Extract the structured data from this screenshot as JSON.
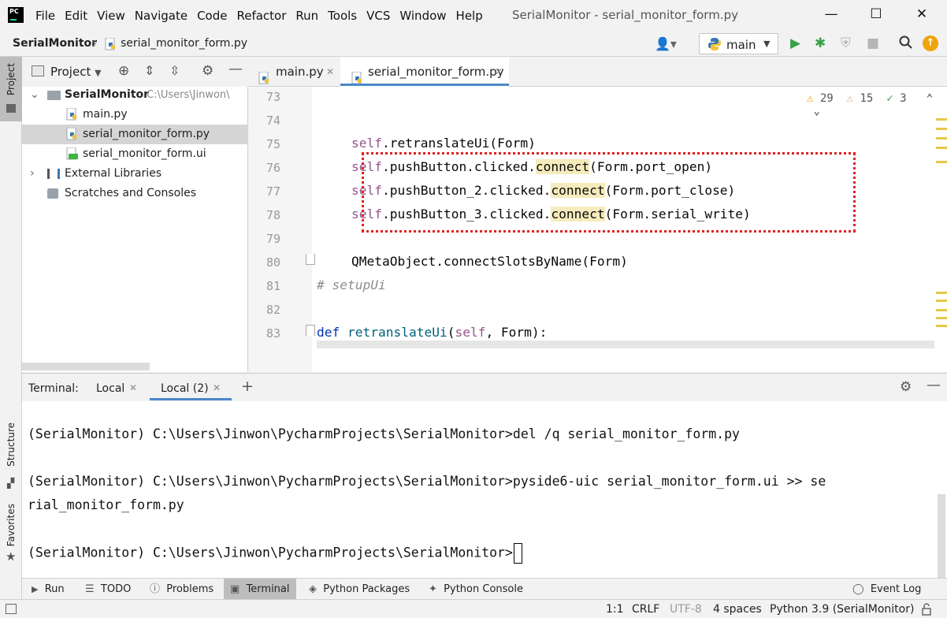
{
  "window": {
    "title": "SerialMonitor - serial_monitor_form.py",
    "logo_text": "PC",
    "menu": [
      "File",
      "Edit",
      "View",
      "Navigate",
      "Code",
      "Refactor",
      "Run",
      "Tools",
      "VCS",
      "Window",
      "Help"
    ],
    "controls": {
      "minimize": "—",
      "maximize": "☐",
      "close": "✕"
    }
  },
  "navbar": {
    "project": "SerialMonitor",
    "separator": "›",
    "file": "serial_monitor_form.py",
    "run_config": "main"
  },
  "left_strip": {
    "project": "Project",
    "structure": "Structure",
    "favorites": "Favorites"
  },
  "project_panel": {
    "title": "Project",
    "tree": [
      {
        "label": "SerialMonitor",
        "path": "C:\\Users\\Jinwon\\",
        "expanded": "⌄"
      },
      {
        "label": "main.py"
      },
      {
        "label": "serial_monitor_form.py"
      },
      {
        "label": "serial_monitor_form.ui"
      },
      {
        "label": "External Libraries",
        "expanded": "›"
      },
      {
        "label": "Scratches and Consoles"
      }
    ]
  },
  "editor_tabs": [
    {
      "label": "main.py",
      "close": "✕"
    },
    {
      "label": "serial_monitor_form.py",
      "close": "✕"
    }
  ],
  "inspections": {
    "warnings": "29",
    "weak_warnings": "15",
    "ok": "3"
  },
  "editor": {
    "line_numbers": [
      "73",
      "74",
      "75",
      "76",
      "77",
      "78",
      "79",
      "80",
      "81",
      "82",
      "83"
    ],
    "lines": {
      "l75_self": "self",
      "l75_rest": ".retranslateUi(Form)",
      "l76_self": "self",
      "l76_a": ".pushButton.clicked.",
      "l76_hl": "connect",
      "l76_b": "(Form.port_open)",
      "l77_self": "self",
      "l77_a": ".pushButton_2.clicked.",
      "l77_hl": "connect",
      "l77_b": "(Form.port_close)",
      "l78_self": "self",
      "l78_a": ".pushButton_3.clicked.",
      "l78_hl": "connect",
      "l78_b": "(Form.serial_write)",
      "l80": "QMetaObject.connectSlotsByName(Form)",
      "l81": "# setupUi",
      "l83_def": "def",
      "l83_name": "retranslateUi",
      "l83_open": "(",
      "l83_self": "self",
      "l83_rest": ", Form):"
    }
  },
  "terminal": {
    "label": "Terminal:",
    "tabs": [
      {
        "label": "Local",
        "close": "✕"
      },
      {
        "label": "Local (2)",
        "close": "✕"
      }
    ],
    "add": "+",
    "lines": [
      "(SerialMonitor) C:\\Users\\Jinwon\\PycharmProjects\\SerialMonitor>del /q serial_monitor_form.py",
      "(SerialMonitor) C:\\Users\\Jinwon\\PycharmProjects\\SerialMonitor>pyside6-uic serial_monitor_form.ui >> se",
      "rial_monitor_form.py",
      "(SerialMonitor) C:\\Users\\Jinwon\\PycharmProjects\\SerialMonitor>"
    ]
  },
  "bottom_toolbar": [
    "Run",
    "TODO",
    "Problems",
    "Terminal",
    "Python Packages",
    "Python Console"
  ],
  "event_log": "Event Log",
  "statusbar": {
    "position": "1:1",
    "line_sep": "CRLF",
    "encoding": "UTF-8",
    "indent": "4 spaces",
    "interpreter": "Python 3.9 (SerialMonitor)"
  },
  "colors": {
    "accent": "#4a88c7",
    "highlight": "#f6ebbc",
    "annotation": "#e02020",
    "run_green": "#3aa14b"
  }
}
